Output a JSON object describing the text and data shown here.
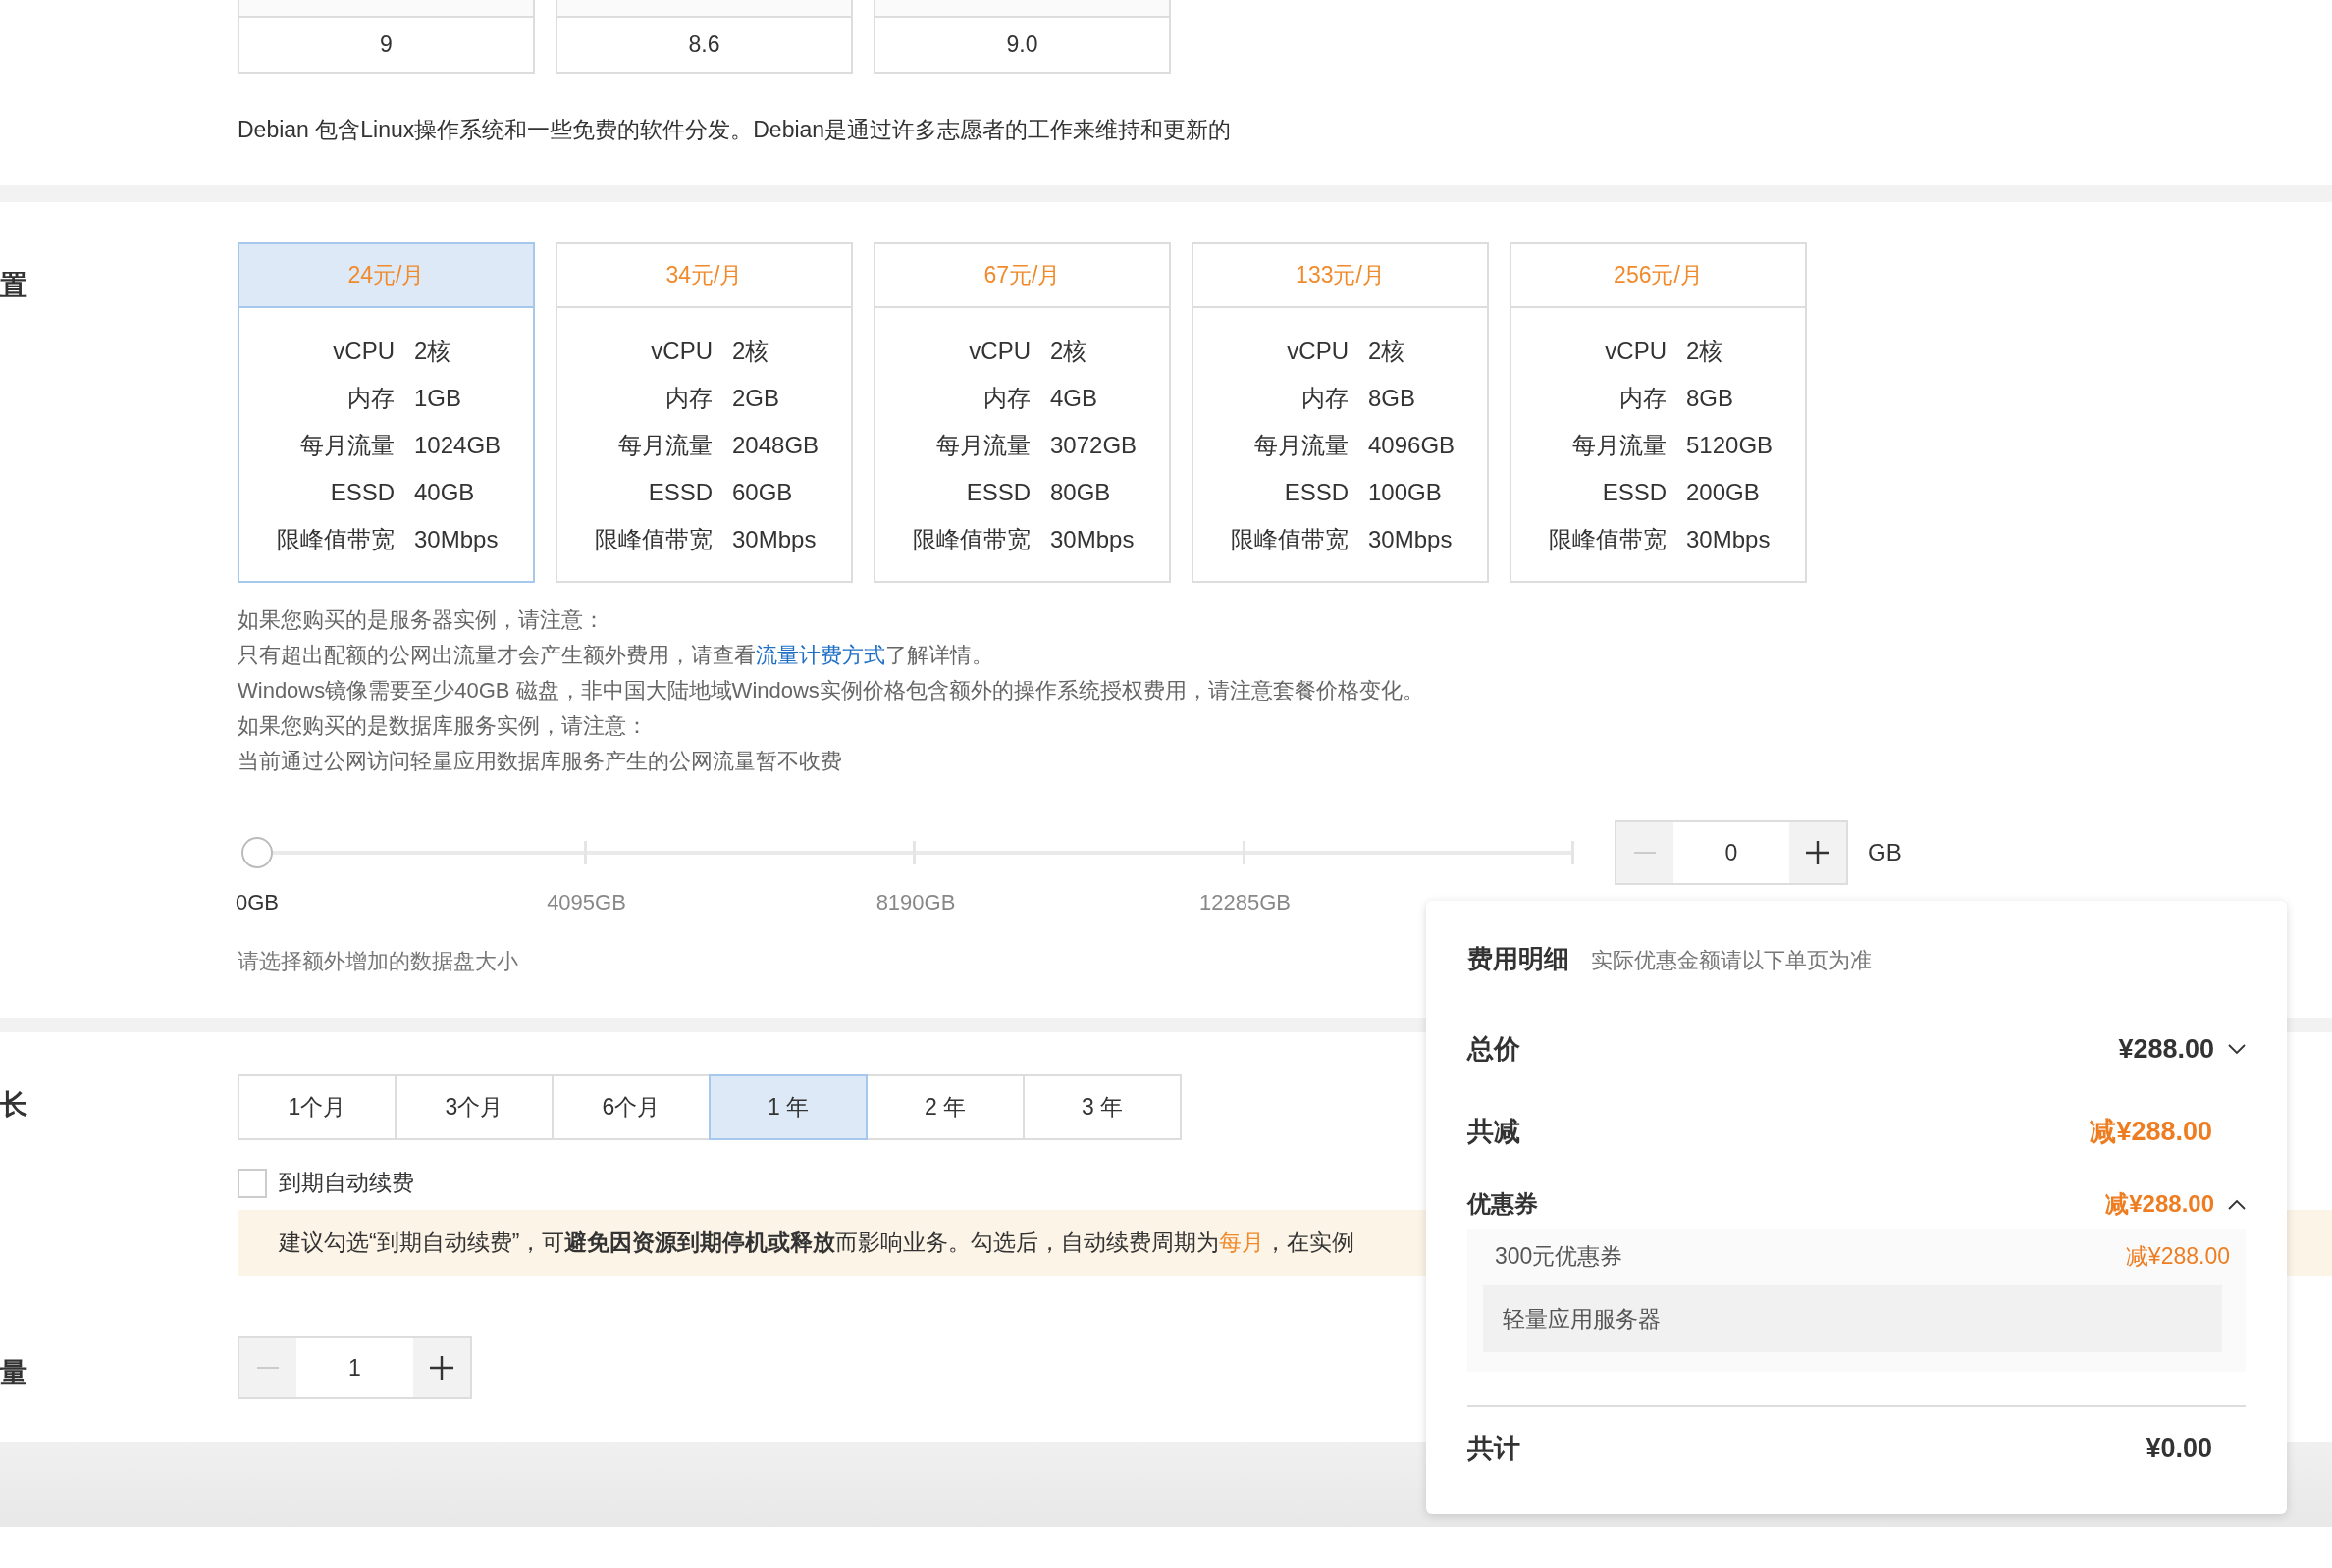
{
  "os_versions": [
    {
      "version": "9"
    },
    {
      "version": "8.6"
    },
    {
      "version": "9.0"
    }
  ],
  "os_description": "Debian 包含Linux操作系统和一些免费的软件分发。Debian是通过许多志愿者的工作来维持和更新的",
  "plan_section": {
    "label": "置",
    "plans": [
      {
        "price": "24元/月",
        "selected": true,
        "specs": [
          {
            "name": "vCPU",
            "value": "2核"
          },
          {
            "name": "内存",
            "value": "1GB"
          },
          {
            "name": "每月流量",
            "value": "1024GB"
          },
          {
            "name": "ESSD",
            "value": "40GB"
          },
          {
            "name": "限峰值带宽",
            "value": "30Mbps"
          }
        ]
      },
      {
        "price": "34元/月",
        "selected": false,
        "specs": [
          {
            "name": "vCPU",
            "value": "2核"
          },
          {
            "name": "内存",
            "value": "2GB"
          },
          {
            "name": "每月流量",
            "value": "2048GB"
          },
          {
            "name": "ESSD",
            "value": "60GB"
          },
          {
            "name": "限峰值带宽",
            "value": "30Mbps"
          }
        ]
      },
      {
        "price": "67元/月",
        "selected": false,
        "specs": [
          {
            "name": "vCPU",
            "value": "2核"
          },
          {
            "name": "内存",
            "value": "4GB"
          },
          {
            "name": "每月流量",
            "value": "3072GB"
          },
          {
            "name": "ESSD",
            "value": "80GB"
          },
          {
            "name": "限峰值带宽",
            "value": "30Mbps"
          }
        ]
      },
      {
        "price": "133元/月",
        "selected": false,
        "specs": [
          {
            "name": "vCPU",
            "value": "2核"
          },
          {
            "name": "内存",
            "value": "8GB"
          },
          {
            "name": "每月流量",
            "value": "4096GB"
          },
          {
            "name": "ESSD",
            "value": "100GB"
          },
          {
            "name": "限峰值带宽",
            "value": "30Mbps"
          }
        ]
      },
      {
        "price": "256元/月",
        "selected": false,
        "specs": [
          {
            "name": "vCPU",
            "value": "2核"
          },
          {
            "name": "内存",
            "value": "8GB"
          },
          {
            "name": "每月流量",
            "value": "5120GB"
          },
          {
            "name": "ESSD",
            "value": "200GB"
          },
          {
            "name": "限峰值带宽",
            "value": "30Mbps"
          }
        ]
      }
    ],
    "notes": [
      {
        "kind": "text",
        "text": "如果您购买的是服务器实例，请注意："
      },
      {
        "kind": "link_line",
        "text_before": "只有超出配额的公网出流量才会产生额外费用，请查看",
        "link": "流量计费方式",
        "text_after": "了解详情。"
      },
      {
        "kind": "text",
        "text": "Windows镜像需要至少40GB 磁盘，非中国大陆地域Windows实例价格包含额外的操作系统授权费用，请注意套餐价格变化。"
      },
      {
        "kind": "text",
        "text": "如果您购买的是数据库服务实例，请注意："
      },
      {
        "kind": "text",
        "text": "当前通过公网访问轻量应用数据库服务产生的公网流量暂不收费"
      }
    ]
  },
  "disk": {
    "slider": {
      "level": 0,
      "ticks": [
        {
          "label": "0GB",
          "selected": true
        },
        {
          "label": "4095GB",
          "selected": false
        },
        {
          "label": "8190GB",
          "selected": false
        },
        {
          "label": "12285GB",
          "selected": false
        }
      ]
    },
    "value": "0",
    "decrease_disabled": true,
    "unit": "GB",
    "hint": "请选择额外增加的数据盘大小"
  },
  "duration": {
    "label": "长",
    "options": [
      {
        "label": "1个月",
        "selected": false
      },
      {
        "label": "3个月",
        "selected": false
      },
      {
        "label": "6个月",
        "selected": false
      },
      {
        "label": "1 年",
        "selected": true
      },
      {
        "label": "2 年",
        "selected": false
      },
      {
        "label": "3 年",
        "selected": false
      }
    ],
    "auto_renew": {
      "label": "到期自动续费",
      "checked": false
    },
    "tip": {
      "text_before": "建议勾选“到期自动续费”，可**避免因资源到期停机或释放**而影响业务。勾选后，自动续费周期为 ",
      "highlight": "每月",
      "text_after": "，在实例"
    }
  },
  "quantity": {
    "label": "量",
    "value": "1",
    "decrease_disabled": true
  },
  "cost_panel": {
    "title": "费用明细",
    "subtitle": "实际优惠金额请以下单页为准",
    "total": {
      "label": "总价",
      "value": "¥288.00",
      "expanded": false
    },
    "discount": {
      "label": "共减",
      "value": "减¥288.00"
    },
    "coupon": {
      "label": "优惠券",
      "value": "减¥288.00",
      "expanded": true,
      "items": [
        {
          "name": "300元优惠券",
          "value": "减¥288.00",
          "scope": "轻量应用服务器"
        }
      ]
    },
    "sum": {
      "label": "共计",
      "value": "¥0.00"
    }
  }
}
